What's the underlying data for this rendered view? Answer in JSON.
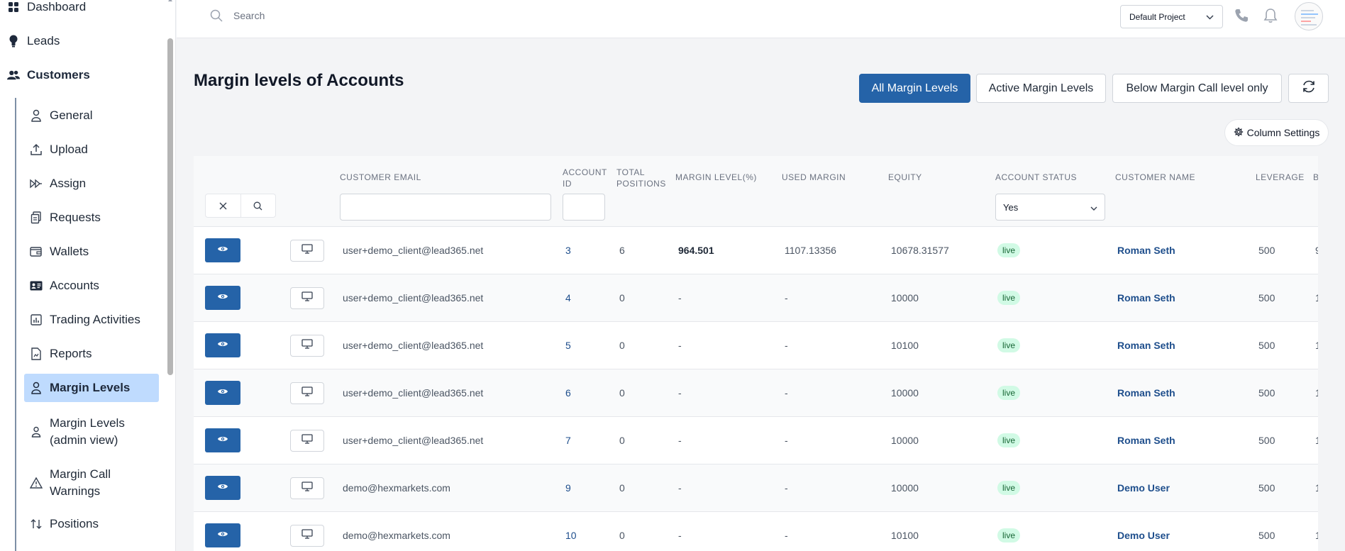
{
  "sidebar": {
    "top_items": [
      {
        "label": "Dashboard",
        "icon": "dashboard-grid-icon"
      },
      {
        "label": "Leads",
        "icon": "lightbulb-icon"
      },
      {
        "label": "Customers",
        "icon": "users-icon"
      }
    ],
    "sub_items": [
      {
        "label": "General",
        "icon": "user-icon"
      },
      {
        "label": "Upload",
        "icon": "upload-icon"
      },
      {
        "label": "Assign",
        "icon": "assign-forward-icon"
      },
      {
        "label": "Requests",
        "icon": "requests-copy-icon"
      },
      {
        "label": "Wallets",
        "icon": "wallet-icon"
      },
      {
        "label": "Accounts",
        "icon": "id-card-icon"
      },
      {
        "label": "Trading Activities",
        "icon": "bar-chart-icon"
      },
      {
        "label": "Reports",
        "icon": "report-file-icon"
      },
      {
        "label": "Margin Levels",
        "icon": "user-icon",
        "active": true
      },
      {
        "label": "Margin Levels (admin view)",
        "icon": "user-small-icon"
      },
      {
        "label": "Margin Call Warnings",
        "icon": "warning-triangle-icon"
      },
      {
        "label": "Positions",
        "icon": "positions-swap-icon"
      }
    ]
  },
  "topbar": {
    "search_placeholder": "Search",
    "project": "Default Project"
  },
  "page": {
    "title": "Margin levels of Accounts",
    "filters": [
      "All Margin Levels",
      "Active Margin Levels",
      "Below Margin Call level only"
    ],
    "active_filter": 0,
    "column_settings": "Column Settings"
  },
  "table": {
    "headers": {
      "customer_email": "CUSTOMER EMAIL",
      "account_id_1": "ACCOUNT",
      "account_id_2": "ID",
      "total_positions_1": "TOTAL",
      "total_positions_2": "POSITIONS",
      "margin_level": "MARGIN LEVEL(%)",
      "used_margin": "USED MARGIN",
      "equity": "EQUITY",
      "account_status": "ACCOUNT STATUS",
      "customer_name": "CUSTOMER NAME",
      "leverage": "LEVERAGE",
      "next_col": "B"
    },
    "status_filter": "Yes",
    "rows": [
      {
        "email": "user+demo_client@lead365.net",
        "account_id": "3",
        "positions": "6",
        "margin_level": "964.501",
        "used_margin": "1107.13356",
        "equity": "10678.31577",
        "status": "live",
        "name": "Roman Seth",
        "leverage": "500",
        "next": "9"
      },
      {
        "email": "user+demo_client@lead365.net",
        "account_id": "4",
        "positions": "0",
        "margin_level": "-",
        "used_margin": "-",
        "equity": "10000",
        "status": "live",
        "name": "Roman Seth",
        "leverage": "500",
        "next": "1"
      },
      {
        "email": "user+demo_client@lead365.net",
        "account_id": "5",
        "positions": "0",
        "margin_level": "-",
        "used_margin": "-",
        "equity": "10100",
        "status": "live",
        "name": "Roman Seth",
        "leverage": "500",
        "next": "1"
      },
      {
        "email": "user+demo_client@lead365.net",
        "account_id": "6",
        "positions": "0",
        "margin_level": "-",
        "used_margin": "-",
        "equity": "10000",
        "status": "live",
        "name": "Roman Seth",
        "leverage": "500",
        "next": "1"
      },
      {
        "email": "user+demo_client@lead365.net",
        "account_id": "7",
        "positions": "0",
        "margin_level": "-",
        "used_margin": "-",
        "equity": "10000",
        "status": "live",
        "name": "Roman Seth",
        "leverage": "500",
        "next": "1"
      },
      {
        "email": "demo@hexmarkets.com",
        "account_id": "9",
        "positions": "0",
        "margin_level": "-",
        "used_margin": "-",
        "equity": "10000",
        "status": "live",
        "name": "Demo User",
        "leverage": "500",
        "next": "1"
      },
      {
        "email": "demo@hexmarkets.com",
        "account_id": "10",
        "positions": "0",
        "margin_level": "-",
        "used_margin": "-",
        "equity": "10100",
        "status": "live",
        "name": "Demo User",
        "leverage": "500",
        "next": "1"
      }
    ]
  },
  "colors": {
    "primary": "#2563a8",
    "active_nav_bg": "#bfdbfe",
    "live_badge_bg": "#d1fae5",
    "link": "#1e4e8c"
  }
}
